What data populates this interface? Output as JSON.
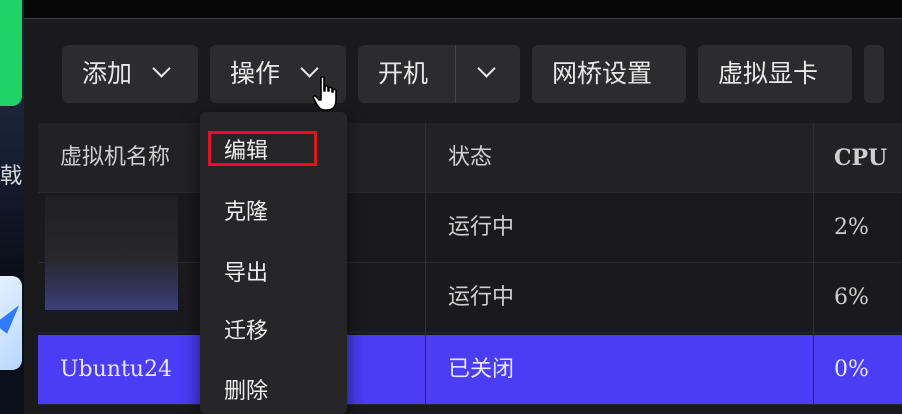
{
  "toolbar": {
    "add_label": "添加",
    "operate_label": "操作",
    "power_label": "开机",
    "bridge_label": "网桥设置",
    "vgpu_label": "虚拟显卡"
  },
  "table": {
    "columns": [
      "虚拟机名称",
      "状态",
      "CPU"
    ],
    "rows": [
      {
        "name": "",
        "status": "运行中",
        "cpu": "2%"
      },
      {
        "name": "",
        "status": "运行中",
        "cpu": "6%"
      },
      {
        "name": "Ubuntu24",
        "status": "已关闭",
        "cpu": "0%"
      }
    ]
  },
  "dropdown": {
    "items": [
      "编辑",
      "克隆",
      "导出",
      "迁移",
      "删除"
    ]
  },
  "desktop": {
    "glyph": "戟"
  },
  "colors": {
    "selected_row": "#4a3df5",
    "highlight_box": "#e0141b"
  }
}
